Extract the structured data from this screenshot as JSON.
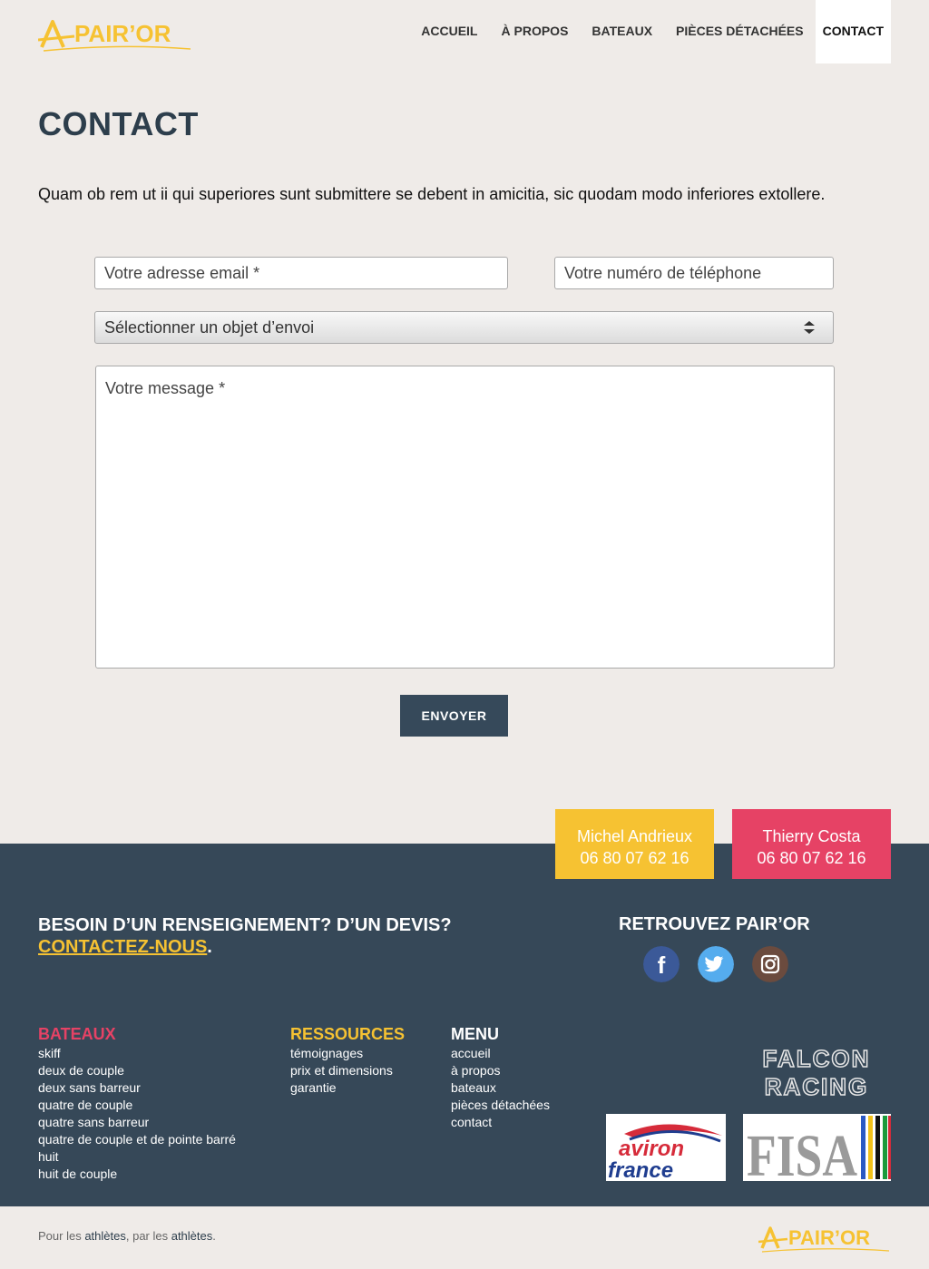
{
  "brand": {
    "name": "PAIR’OR",
    "logo_mark": "A"
  },
  "nav": {
    "items": [
      {
        "label": "ACCUEIL"
      },
      {
        "label": "À PROPOS"
      },
      {
        "label": "BATEAUX"
      },
      {
        "label": "PIÈCES DÉTACHÉES"
      },
      {
        "label": "CONTACT"
      }
    ],
    "active": "CONTACT"
  },
  "page": {
    "title": "CONTACT",
    "intro": "Quam ob rem ut ii qui superiores sunt submittere se debent in amicitia, sic quodam modo inferiores extollere."
  },
  "form": {
    "email_placeholder": "Votre adresse email *",
    "phone_placeholder": "Votre numéro de téléphone",
    "subject_selected": "Sélectionner un objet d’envoi",
    "message_placeholder": "Votre message *",
    "submit_label": "ENVOYER"
  },
  "contacts": [
    {
      "name": "Michel Andrieux",
      "phone": "06 80 07 62 16",
      "color": "#f6c232"
    },
    {
      "name": "Thierry Costa",
      "phone": "06 80 07 62 16",
      "color": "#e64265"
    }
  ],
  "footer": {
    "cta_line": "BESOIN D’UN RENSEIGNEMENT? D’UN DEVIS?",
    "cta_link": "CONTACTEZ-NOUS",
    "cta_suffix": ".",
    "social_title": "RETROUVEZ PAIR’OR",
    "social": [
      {
        "name": "facebook-icon",
        "color": "#3b5998",
        "glyph": "f"
      },
      {
        "name": "twitter-icon",
        "color": "#55acee"
      },
      {
        "name": "instagram-icon",
        "color": "#6b4b3e"
      }
    ],
    "columns": [
      {
        "title": "BATEAUX",
        "color": "#e64265",
        "items": [
          "skiff",
          "deux de couple",
          "deux sans barreur",
          "quatre de couple",
          "quatre sans barreur",
          "quatre de couple et de pointe barré",
          "huit",
          "huit de couple"
        ]
      },
      {
        "title": "RESSOURCES",
        "color": "#f6c232",
        "items": [
          "témoignages",
          "prix et dimensions",
          "garantie"
        ]
      },
      {
        "title": "MENU",
        "color": "#ffffff",
        "items": [
          "accueil",
          "à propos",
          "bateaux",
          "pièces détachées",
          "contact"
        ]
      }
    ],
    "partners": {
      "falcon_line1": "FALCON",
      "falcon_line2": "RACING",
      "aviron_line1": "aviron",
      "aviron_line2": "france",
      "fisa": "FISA"
    },
    "tagline": {
      "t1": "Pour les ",
      "b1": "athlètes",
      "t2": ", par les ",
      "b2": "athlètes",
      "t3": "."
    }
  },
  "colors": {
    "accent_yellow": "#f6c232",
    "accent_red": "#e64265",
    "navy": "#364858",
    "background": "#efebe8"
  }
}
